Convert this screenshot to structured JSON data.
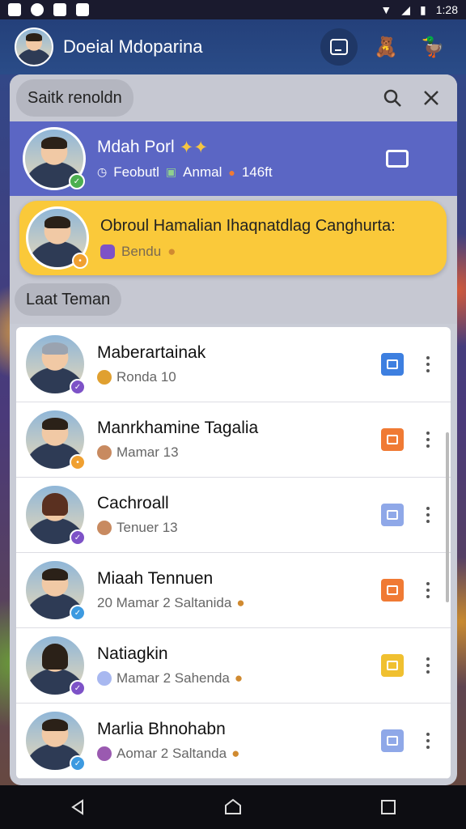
{
  "status": {
    "time": "1:28"
  },
  "appbar": {
    "title": "Doeial Mdoparina"
  },
  "search": {
    "label": "Saitk renoldn"
  },
  "profile": {
    "name": "Mdah Porl",
    "tags": [
      "Feobutl",
      "Anmal",
      "146ft"
    ]
  },
  "highlight": {
    "title": "Obroul Hamalian Ihaqnatdlag Canghurta:",
    "subtitle": "Bendu"
  },
  "section": {
    "label": "Laat Teman"
  },
  "friends": [
    {
      "name": "Maberartainak",
      "sub": "Ronda 10",
      "action_color": "#3d7fe0",
      "badge_color": "#7d52c7",
      "mini_color": "#e0a030"
    },
    {
      "name": "Manrkhamine Tagalia",
      "sub": "Mamar 13",
      "action_color": "#f07a34",
      "badge_color": "#f0a030",
      "mini_color": "#c88a60"
    },
    {
      "name": "Cachroall",
      "sub": "Tenuer 13",
      "action_color": "#8fa8e8",
      "badge_color": "#7d52c7",
      "mini_color": "#c88a60"
    },
    {
      "name": "Miaah Tennuen",
      "sub": "20 Mamar 2 Saltanida",
      "action_color": "#f07a34",
      "badge_color": "#3d9ae0",
      "mini_color": ""
    },
    {
      "name": "Natiagkin",
      "sub": "Mamar 2 Sahenda",
      "action_color": "#f0c030",
      "badge_color": "#7d52c7",
      "mini_color": "#a8b8f0"
    },
    {
      "name": "Marlia Bhnohabn",
      "sub": "Aomar 2 Saltanda",
      "action_color": "#8fa8e8",
      "badge_color": "#3d9ae0",
      "mini_color": "#9a5ab0"
    }
  ]
}
